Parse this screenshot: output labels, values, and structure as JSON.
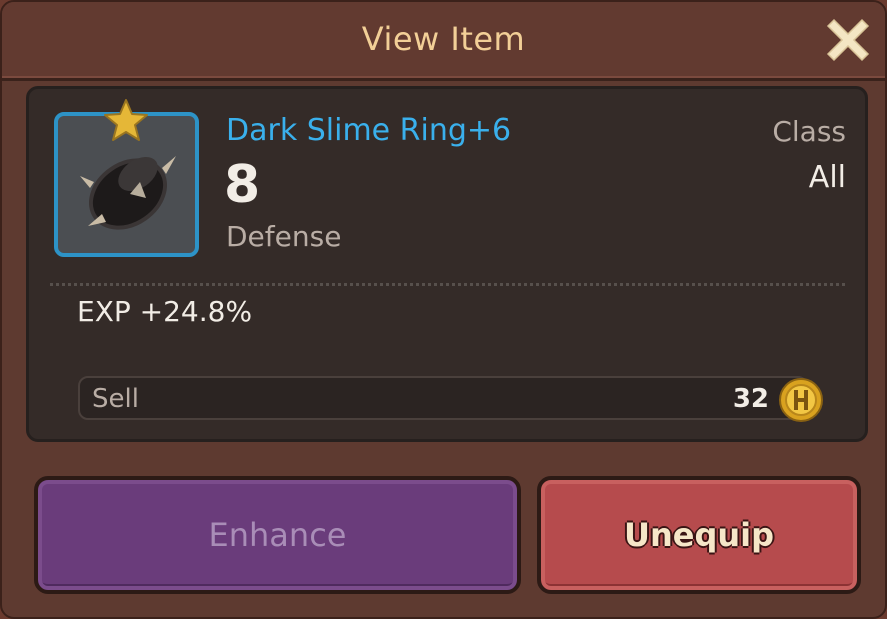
{
  "dialog": {
    "title": "View Item",
    "close_icon": "close-x-icon"
  },
  "item": {
    "icon": "spiked-ring-icon",
    "badge_icon": "gold-star-icon",
    "name": "Dark Slime Ring+6",
    "value": "8",
    "stat": "Defense",
    "class_label": "Class",
    "class_value": "All",
    "bonus": "EXP +24.8%"
  },
  "sell": {
    "label": "Sell",
    "price": "32",
    "currency_icon": "gold-coin-icon"
  },
  "buttons": {
    "enhance": "Enhance",
    "unequip": "Unequip"
  },
  "colors": {
    "item_name": "#3ab0ec",
    "title": "#f2cf97",
    "enhance_button": "#6a3c7b",
    "unequip_button": "#b64b4d"
  }
}
